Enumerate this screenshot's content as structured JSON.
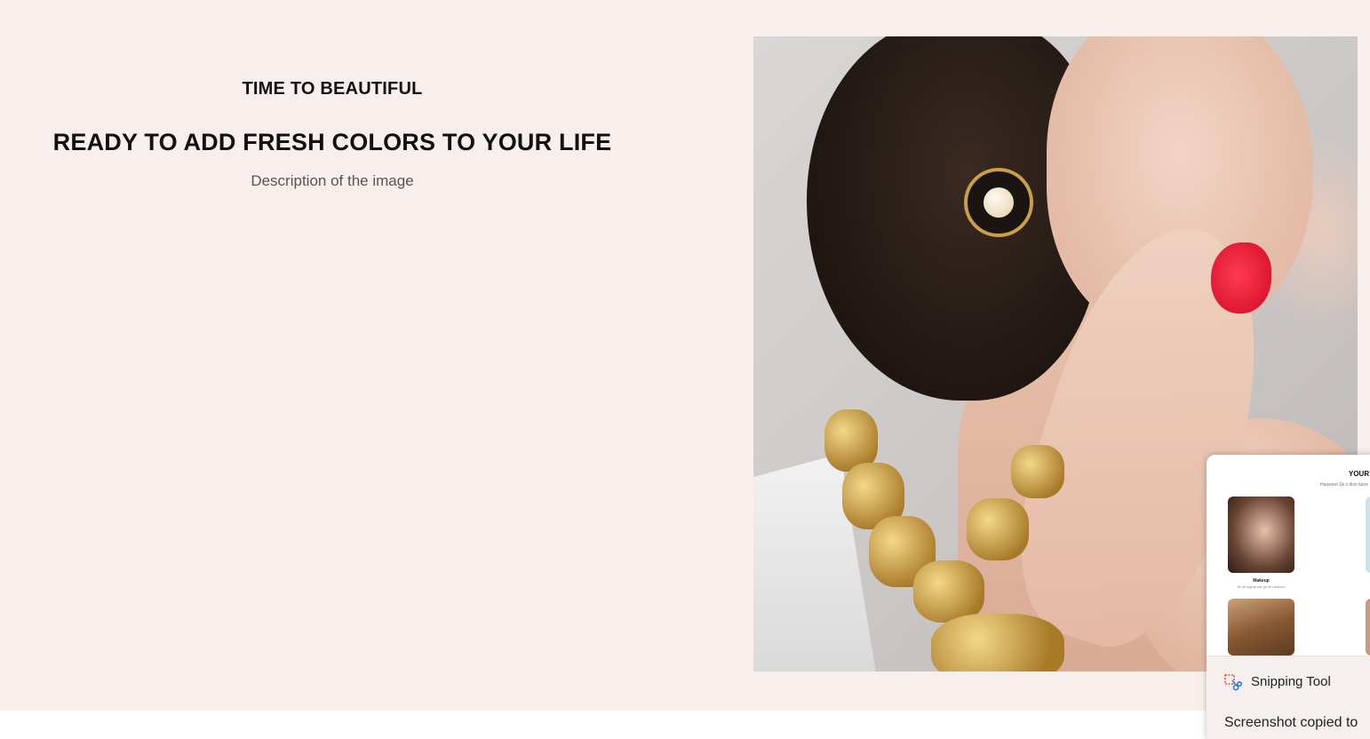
{
  "section": {
    "kicker": "TIME TO BEAUTIFUL",
    "headline": "READY TO ADD FRESH COLORS TO YOUR LIFE",
    "description": "Description of the image"
  },
  "toast": {
    "app_name": "Snipping Tool",
    "message": "Screenshot copied to",
    "icon": "snipping-tool-icon",
    "preview": {
      "title": "YOUR S",
      "subtitle": "Hassmet Sk n dkin fukre",
      "card_label": "Makeup",
      "card_sublabel": "lift ofl eights nat gh ofl uldence"
    }
  }
}
